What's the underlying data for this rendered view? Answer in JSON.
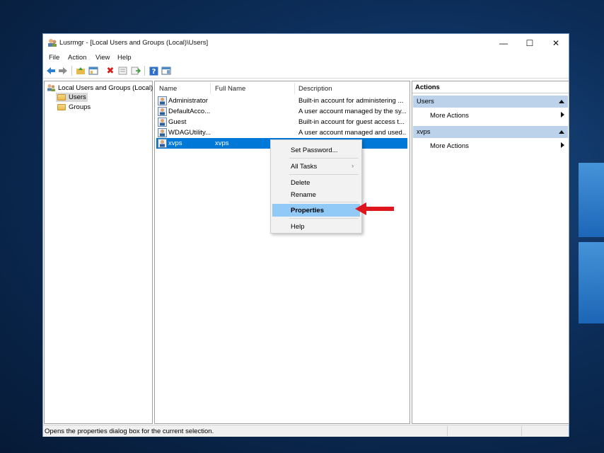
{
  "window": {
    "title": "Lusrmgr - [Local Users and Groups (Local)\\Users]",
    "minimize_glyph": "—",
    "maximize_glyph": "☐",
    "close_glyph": "✕"
  },
  "menu": [
    "File",
    "Action",
    "View",
    "Help"
  ],
  "toolbar": {
    "icons": [
      "back-arrow-icon",
      "forward-arrow-icon",
      "up-folder-icon",
      "show-hide-tree-icon",
      "delete-icon",
      "properties-icon",
      "export-list-icon",
      "help-icon",
      "show-hide-action-pane-icon"
    ]
  },
  "tree": {
    "root": "Local Users and Groups (Local)",
    "items": [
      "Users",
      "Groups"
    ],
    "selected": "Users"
  },
  "list": {
    "columns": [
      "Name",
      "Full Name",
      "Description"
    ],
    "rows": [
      {
        "name": "Administrator",
        "full_name": "",
        "description": "Built-in account for administering ..."
      },
      {
        "name": "DefaultAcco...",
        "full_name": "",
        "description": "A user account managed by the sy..."
      },
      {
        "name": "Guest",
        "full_name": "",
        "description": "Built-in account for guest access t..."
      },
      {
        "name": "WDAGUtility...",
        "full_name": "",
        "description": "A user account managed and used..."
      },
      {
        "name": "xvps",
        "full_name": "xvps",
        "description": ""
      }
    ],
    "selected_row": 4
  },
  "context_menu": {
    "set_password": "Set Password...",
    "all_tasks": "All Tasks",
    "all_tasks_arrow": "›",
    "delete": "Delete",
    "rename": "Rename",
    "properties": "Properties",
    "help": "Help",
    "highlighted": "Properties"
  },
  "actions": {
    "header": "Actions",
    "sections": [
      {
        "title": "Users",
        "link": "More Actions"
      },
      {
        "title": "xvps",
        "link": "More Actions"
      }
    ]
  },
  "status": {
    "text": "Opens the properties dialog box for the current selection."
  },
  "colors": {
    "selection": "#0078d7",
    "menu_highlight": "#91c9f7",
    "annotation_arrow": "#e0161e",
    "actions_section": "#bcd2ea"
  }
}
